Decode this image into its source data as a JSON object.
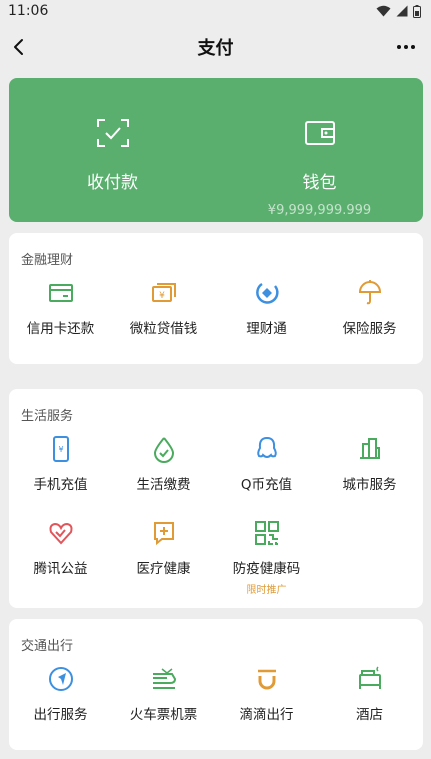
{
  "status_bar": {
    "time": "11:06",
    "icons": [
      "wifi-icon",
      "signal-icon",
      "battery-icon"
    ]
  },
  "nav": {
    "title": "支付",
    "back_icon": "back-arrow-icon",
    "more_icon": "more-icon"
  },
  "hero": {
    "color": "#5aaf6e",
    "items": [
      {
        "label": "收付款",
        "icon": "scan-pay-icon"
      },
      {
        "label": "钱包",
        "icon": "wallet-icon",
        "sub": "¥9,999,999.999"
      }
    ]
  },
  "sections": [
    {
      "title": "金融理财",
      "items": [
        {
          "label": "信用卡还款",
          "icon": "credit-card-icon"
        },
        {
          "label": "微粒贷借钱",
          "icon": "loan-icon"
        },
        {
          "label": "理财通",
          "icon": "wealth-icon"
        },
        {
          "label": "保险服务",
          "icon": "insurance-icon"
        }
      ]
    },
    {
      "title": "生活服务",
      "items": [
        {
          "label": "手机充值",
          "icon": "phone-topup-icon"
        },
        {
          "label": "生活缴费",
          "icon": "utility-payment-icon"
        },
        {
          "label": "Q币充值",
          "icon": "qq-coin-icon"
        },
        {
          "label": "城市服务",
          "icon": "city-service-icon"
        },
        {
          "label": "腾讯公益",
          "icon": "charity-icon"
        },
        {
          "label": "医疗健康",
          "icon": "medical-icon"
        },
        {
          "label": "防疫健康码",
          "icon": "health-code-icon",
          "tag": "限时推广"
        }
      ]
    },
    {
      "title": "交通出行",
      "items": [
        {
          "label": "出行服务",
          "icon": "travel-icon"
        },
        {
          "label": "火车票机票",
          "icon": "train-icon"
        },
        {
          "label": "滴滴出行",
          "icon": "didi-icon"
        },
        {
          "label": "酒店",
          "icon": "hotel-icon"
        }
      ]
    }
  ]
}
